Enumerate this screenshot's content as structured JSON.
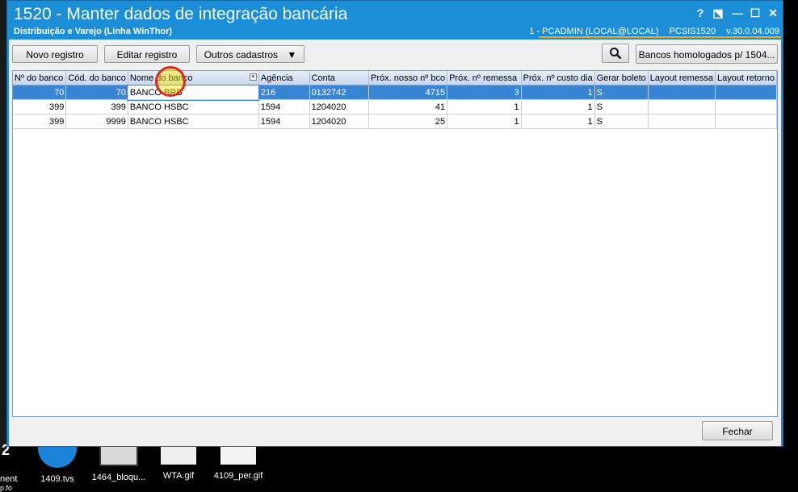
{
  "window": {
    "title": "1520 - Manter dados de integração bancária",
    "subtitle": "Distribuição e Varejo (Linha WinThor)",
    "status": {
      "user": "1 - PCADMIN (LOCAL@LOCAL)",
      "routine": "PCSIS1520",
      "version": "v.30.0.04.009"
    },
    "controls": {
      "help": "?",
      "restore": "⬔",
      "minimize": "—",
      "maximize": "☐",
      "close": "✕"
    }
  },
  "toolbar": {
    "new_record": "Novo registro",
    "edit_record": "Editar registro",
    "other_registers": "Outros cadastros",
    "dropdown_arrow": "▼",
    "search_icon": "search-icon",
    "approved_banks": "Bancos homologados p/ 1504..."
  },
  "grid": {
    "columns": [
      "Nº do banco",
      "Cód. do banco",
      "Nome do banco",
      "Agência",
      "Conta",
      "Próx. nosso nº bco",
      "Próx. nº remessa",
      "Próx. nº custo dia",
      "Gerar boleto",
      "Layout remessa",
      "Layout retorno"
    ],
    "rows": [
      [
        "70",
        "70",
        "BANCO BRB",
        "216",
        "0132742",
        "4715",
        "3",
        "1",
        "S",
        "",
        ""
      ],
      [
        "399",
        "399",
        "BANCO HSBC",
        "1594",
        "1204020",
        "41",
        "1",
        "1",
        "S",
        "",
        ""
      ],
      [
        "399",
        "9999",
        "BANCO HSBC",
        "1594",
        "1204020",
        "25",
        "1",
        "1",
        "S",
        "",
        ""
      ]
    ],
    "filter_icon": "filter-icon"
  },
  "footer": {
    "close": "Fechar"
  },
  "desktop": {
    "icons": [
      {
        "label": "1409.tvs"
      },
      {
        "label": "1464_bloqu..."
      },
      {
        "label": "WTA.gif"
      },
      {
        "label": "4109_per.gif"
      }
    ],
    "fragments": {
      "left_a": "nent",
      "left_b": "p.fo",
      "left_num": "2"
    }
  },
  "colors": {
    "titlebar": "#1c8ed8",
    "selection": "#3a84d4",
    "accent": "#f2a51a"
  }
}
